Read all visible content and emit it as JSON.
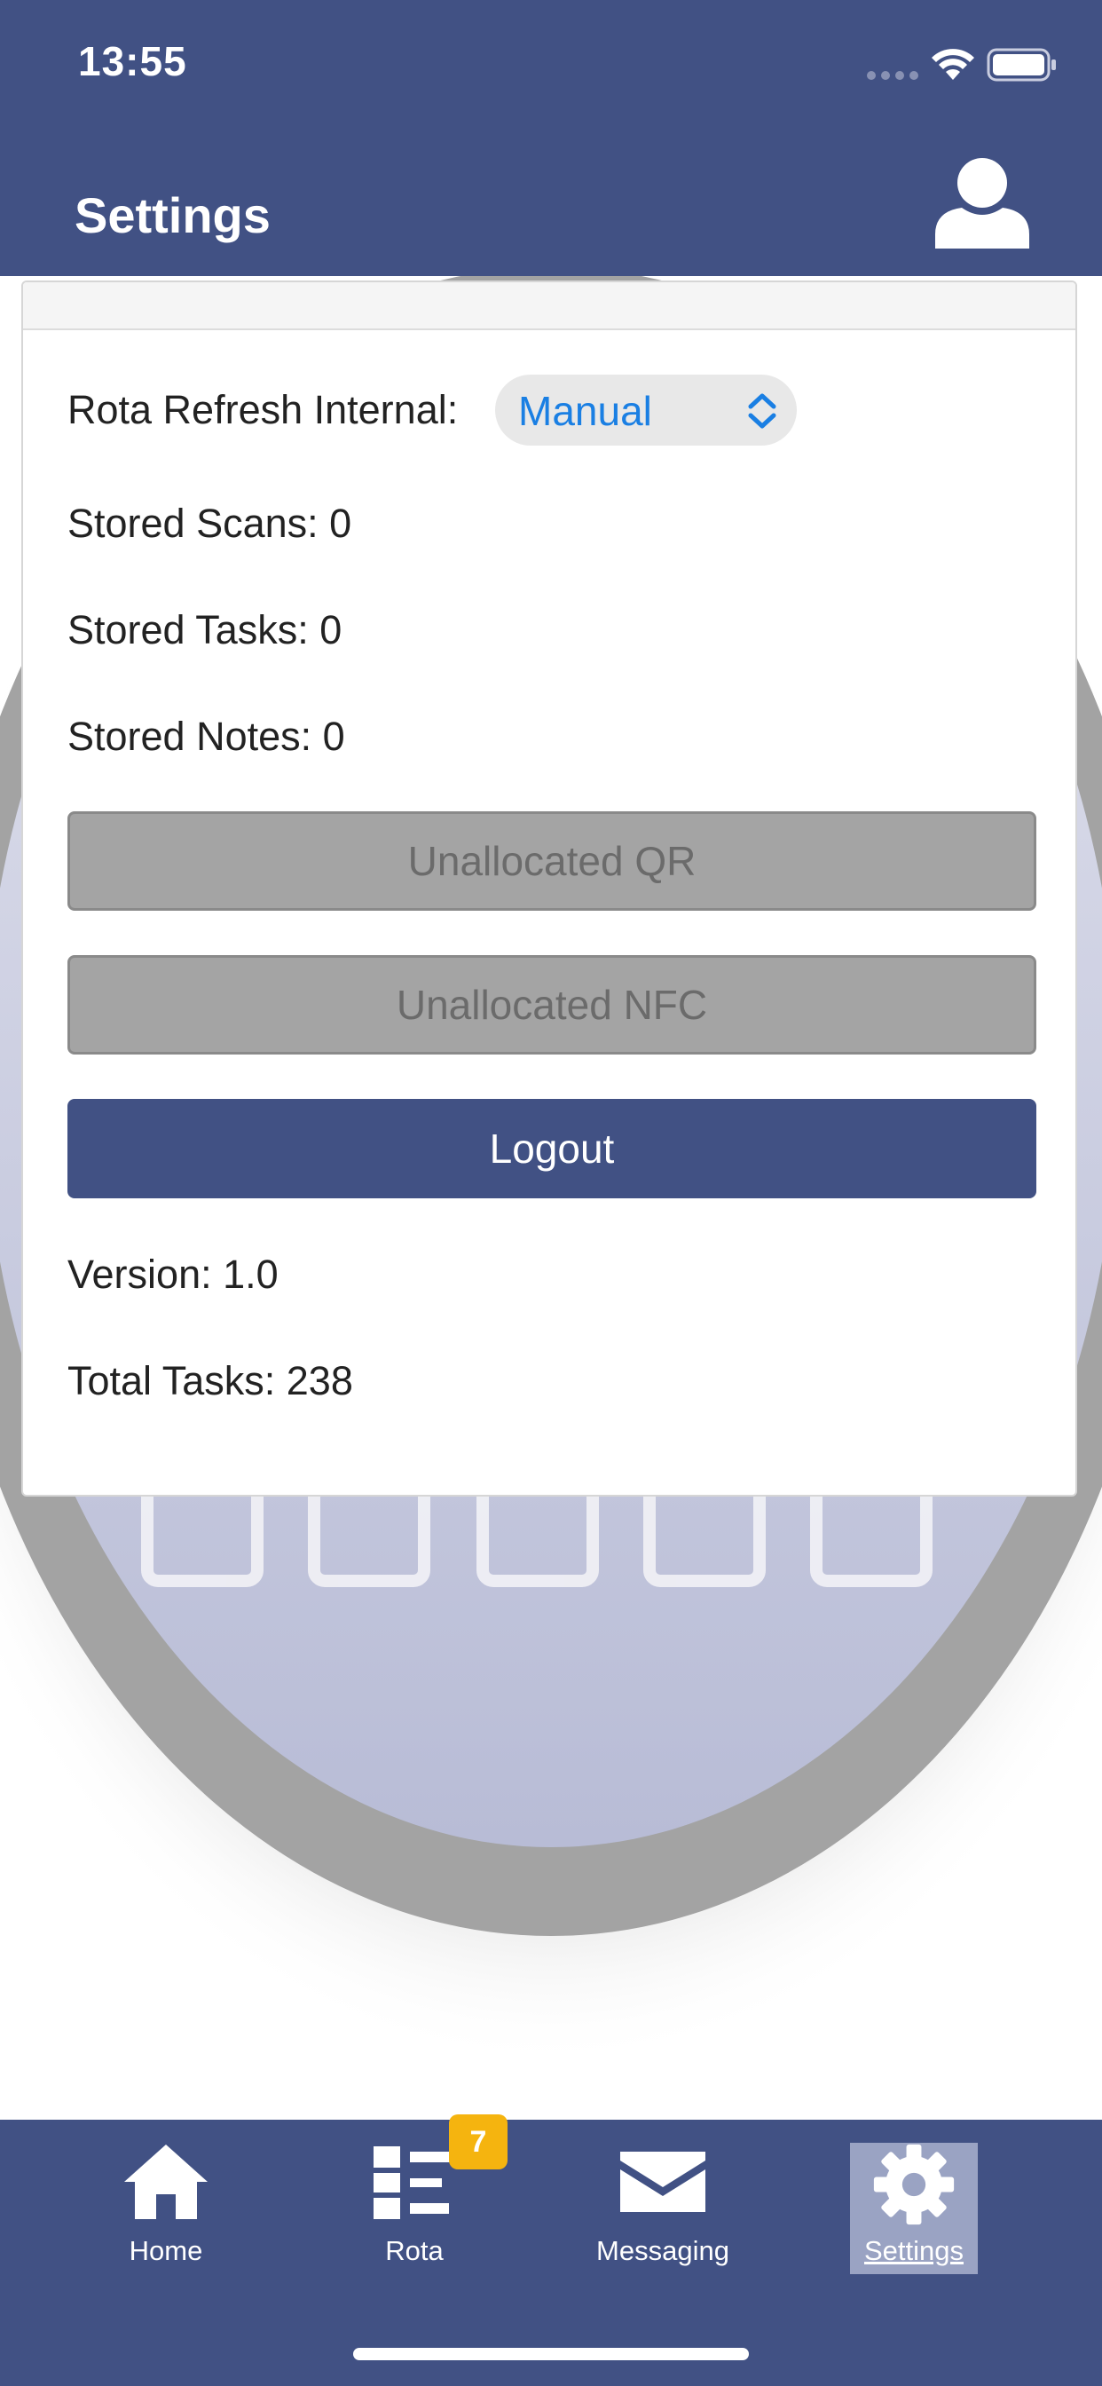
{
  "status_bar": {
    "time": "13:55"
  },
  "header": {
    "title": "Settings",
    "profile_icon": "person-icon"
  },
  "settings": {
    "refresh_label": "Rota Refresh Internal:",
    "refresh_value": "Manual",
    "stored_scans": "Stored Scans: 0",
    "stored_tasks": "Stored Tasks: 0",
    "stored_notes": "Stored Notes: 0",
    "unallocated_qr": "Unallocated QR",
    "unallocated_nfc": "Unallocated NFC",
    "logout": "Logout",
    "version": "Version: 1.0",
    "total_tasks": "Total Tasks: 238"
  },
  "tabbar": {
    "home": "Home",
    "rota": "Rota",
    "rota_badge": "7",
    "messaging": "Messaging",
    "settings": "Settings",
    "active": "Settings"
  },
  "colors": {
    "primary": "#415184",
    "badge": "#f5b40f",
    "select_text": "#1a7fe3",
    "disabled_button": "#a4a4a4"
  }
}
